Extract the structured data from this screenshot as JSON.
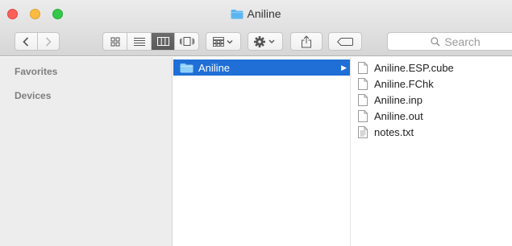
{
  "window": {
    "title": "Aniline"
  },
  "toolbar": {
    "search_placeholder": "Search"
  },
  "sidebar": {
    "sections": [
      {
        "label": "Favorites"
      },
      {
        "label": "Devices"
      }
    ]
  },
  "columns": {
    "column1": {
      "items": [
        {
          "label": "Aniline",
          "type": "folder",
          "selected": true
        }
      ]
    },
    "column2": {
      "items": [
        {
          "label": "Aniline.ESP.cube",
          "type": "file"
        },
        {
          "label": "Aniline.FChk",
          "type": "file"
        },
        {
          "label": "Aniline.inp",
          "type": "file"
        },
        {
          "label": "Aniline.out",
          "type": "file"
        },
        {
          "label": "notes.txt",
          "type": "text-file"
        }
      ]
    }
  },
  "colors": {
    "selection": "#1f6fd6",
    "folder": "#5bb6f0",
    "close": "#fc605b",
    "minimize": "#fdbc40",
    "zoom": "#34c84a"
  }
}
